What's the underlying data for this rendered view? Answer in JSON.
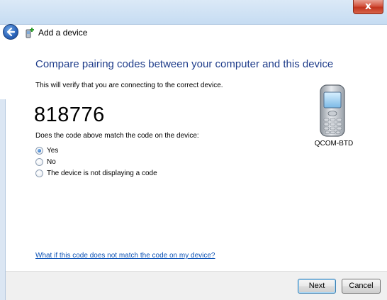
{
  "window": {
    "close_label": "x"
  },
  "nav": {
    "title": "Add a device"
  },
  "main": {
    "heading": "Compare pairing codes between your computer and this device",
    "subtitle": "This will verify that you are connecting to the correct device.",
    "code": "818776",
    "question": "Does the code above match the code on the device:",
    "options": [
      {
        "label": "Yes",
        "checked": true
      },
      {
        "label": "No",
        "checked": false
      },
      {
        "label": "The device is not displaying a code",
        "checked": false
      }
    ],
    "device_name": "QCOM-BTD",
    "help_link": "What if this code does not match the code on my device?"
  },
  "footer": {
    "next_label": "Next",
    "cancel_label": "Cancel"
  },
  "colors": {
    "heading": "#1e3c8a",
    "link": "#0c52b6",
    "close_button": "#c2341d"
  },
  "icons": {
    "back": "back-arrow-icon",
    "add_device": "add-device-icon",
    "device": "mobile-phone-icon"
  }
}
